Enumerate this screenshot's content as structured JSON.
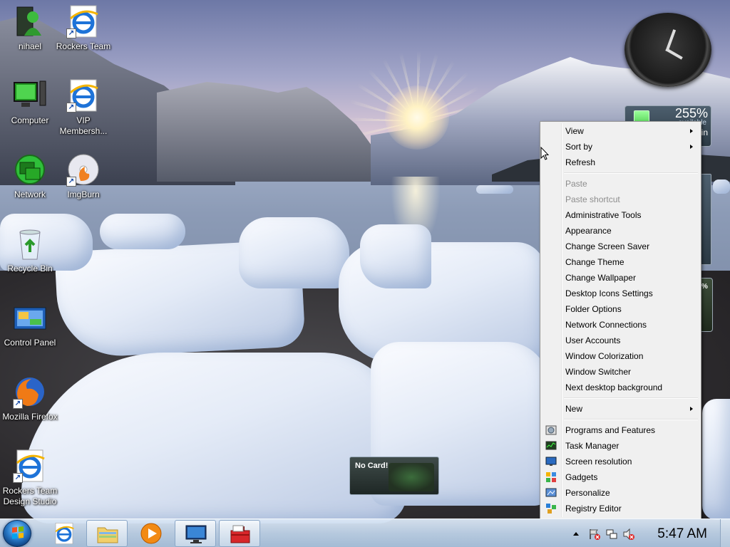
{
  "desktop_icons": [
    {
      "label": "nihael",
      "icon": "user-folder-icon",
      "shortcut": false
    },
    {
      "label": "Rockers Team",
      "icon": "internet-explorer-icon",
      "shortcut": true
    },
    {
      "label": "Computer",
      "icon": "computer-icon",
      "shortcut": false
    },
    {
      "label": "VIP Membersh...",
      "icon": "internet-explorer-icon",
      "shortcut": true
    },
    {
      "label": "Network",
      "icon": "network-icon",
      "shortcut": false
    },
    {
      "label": "ImgBurn",
      "icon": "imgburn-icon",
      "shortcut": true
    },
    {
      "label": "Recycle Bin",
      "icon": "recycle-bin-icon",
      "shortcut": false
    },
    {
      "label": "Control Panel",
      "icon": "control-panel-icon",
      "shortcut": false
    },
    {
      "label": "Mozilla Firefox",
      "icon": "firefox-icon",
      "shortcut": true
    },
    {
      "label": "Rockers Team Design Studio",
      "icon": "internet-explorer-icon",
      "shortcut": true
    }
  ],
  "gadgets": {
    "battery_percent": "255%",
    "battery_status": "available",
    "battery_extra": "in",
    "meter_value": "%",
    "no_card": "No Card!"
  },
  "context_menu": {
    "groups": [
      [
        {
          "label": "View",
          "submenu": true
        },
        {
          "label": "Sort by",
          "submenu": true
        },
        {
          "label": "Refresh"
        }
      ],
      [
        {
          "label": "Paste",
          "disabled": true
        },
        {
          "label": "Paste shortcut",
          "disabled": true
        },
        {
          "label": "Administrative Tools"
        },
        {
          "label": "Appearance"
        },
        {
          "label": "Change Screen Saver"
        },
        {
          "label": "Change Theme"
        },
        {
          "label": "Change Wallpaper"
        },
        {
          "label": "Desktop Icons Settings"
        },
        {
          "label": "Folder Options"
        },
        {
          "label": "Network Connections"
        },
        {
          "label": "User Accounts"
        },
        {
          "label": "Window Colorization"
        },
        {
          "label": "Window Switcher"
        },
        {
          "label": "Next desktop background"
        }
      ],
      [
        {
          "label": "New",
          "submenu": true
        }
      ],
      [
        {
          "label": "Programs and Features",
          "icon": "programs-features-icon"
        },
        {
          "label": "Task Manager",
          "icon": "task-manager-icon"
        },
        {
          "label": "Screen resolution",
          "icon": "screen-resolution-icon"
        },
        {
          "label": "Gadgets",
          "icon": "gadgets-icon"
        },
        {
          "label": "Personalize",
          "icon": "personalize-icon"
        },
        {
          "label": "Registry Editor",
          "icon": "registry-editor-icon"
        }
      ]
    ]
  },
  "taskbar": {
    "pinned": [
      {
        "name": "internet-explorer",
        "icon": "internet-explorer-icon",
        "active": false
      },
      {
        "name": "windows-explorer",
        "icon": "folder-icon",
        "active": true
      },
      {
        "name": "media-player",
        "icon": "media-player-icon",
        "active": false
      },
      {
        "name": "remote-desktop",
        "icon": "monitor-icon",
        "active": true
      },
      {
        "name": "toolbox",
        "icon": "toolbox-icon",
        "active": true
      }
    ],
    "clock": "5:47 AM"
  },
  "colors": {
    "menu_bg": "#f0f0f0",
    "menu_disabled": "#8d8d8d",
    "taskbar": "#c8dbef"
  }
}
